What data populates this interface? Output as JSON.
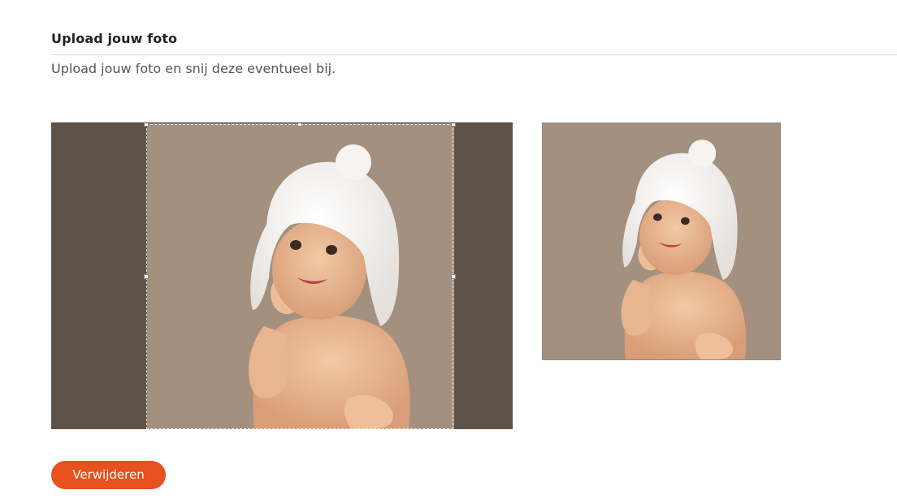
{
  "upload": {
    "title": "Upload jouw foto",
    "description": "Upload jouw foto en snij deze eventueel bij.",
    "remove_label": "Verwijderen"
  },
  "colors": {
    "background_photo": "#a4907f",
    "overlay_dim": "#5e5048",
    "button_accent": "#e8501e"
  }
}
